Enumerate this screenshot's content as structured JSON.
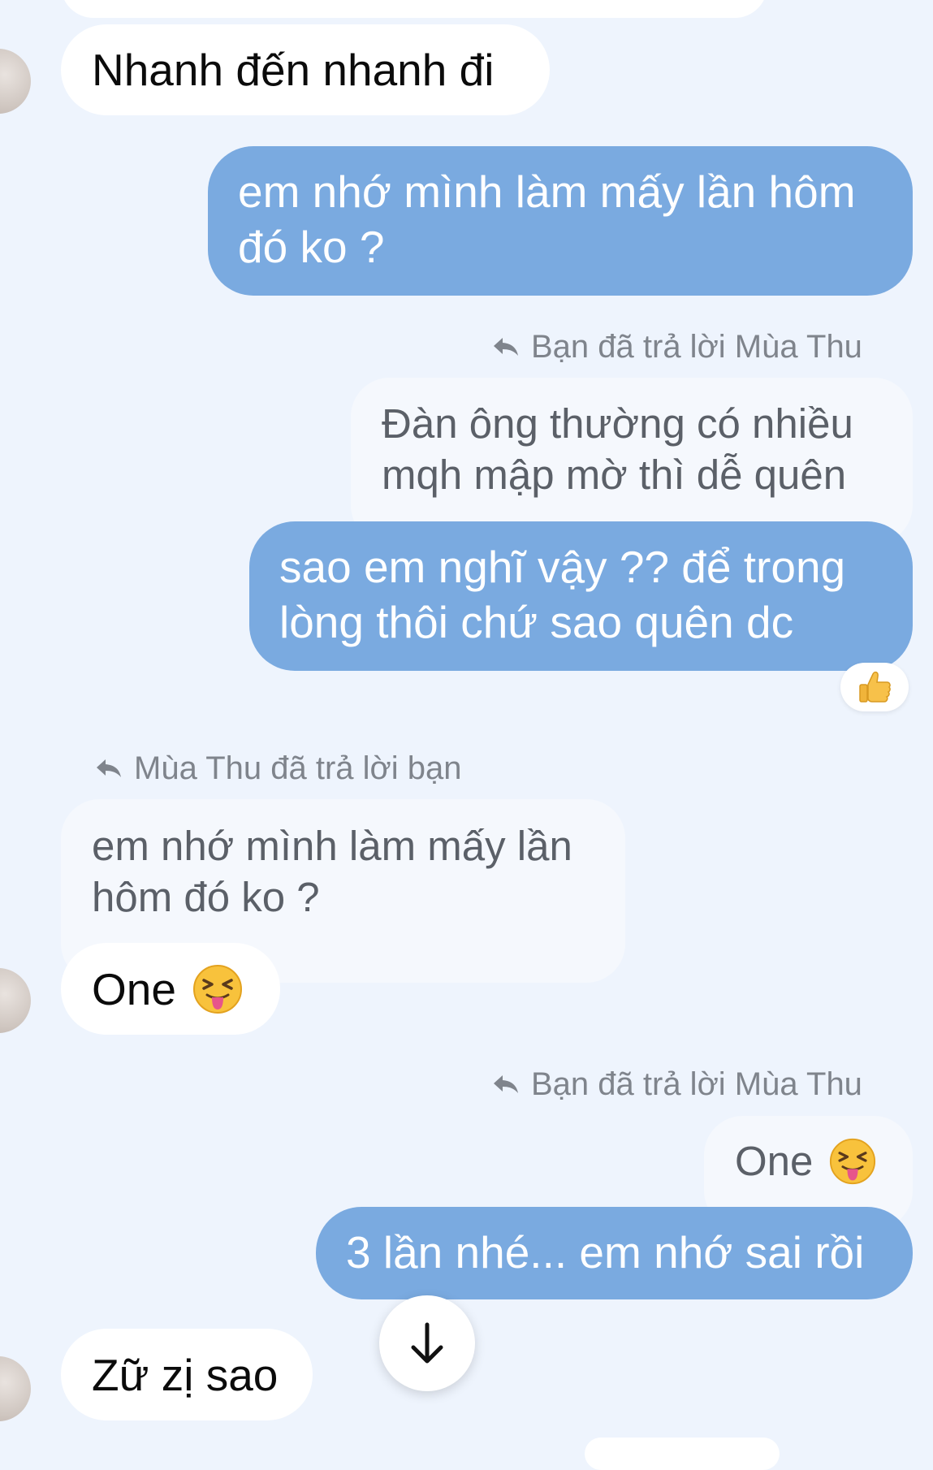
{
  "messages": {
    "m1": {
      "text": "Nhanh đến nhanh đi"
    },
    "m2": {
      "line1": "em nhớ mình làm mấy lần hôm",
      "line2": "đó ko ?"
    },
    "r1": {
      "note": "Bạn đã trả lời Mùa Thu",
      "quote_line1": "Đàn ông thường có nhiều",
      "quote_line2": "mqh mập mờ thì dễ quên"
    },
    "m3": {
      "line1": "sao em nghĩ vậy ?? để trong",
      "line2": "lòng thôi chứ sao quên dc",
      "reaction": "thumbs-up"
    },
    "r2": {
      "note": "Mùa Thu đã trả lời bạn",
      "quote_line1": "em nhớ mình làm mấy lần",
      "quote_line2": "hôm đó ko ?"
    },
    "m4": {
      "text": "One",
      "emoji": "squinting-tongue-face"
    },
    "r3": {
      "note": "Bạn đã trả lời Mùa Thu",
      "quote_text": "One",
      "quote_emoji": "squinting-tongue-face"
    },
    "m5": {
      "text": "3 lần nhé... em nhớ sai rồi"
    },
    "m6": {
      "text": "Zữ zị sao"
    }
  },
  "icons": {
    "reply": "reply-arrow-icon",
    "scroll": "arrow-down-icon"
  },
  "colors": {
    "background": "#eef4fd",
    "outgoing_bubble": "#7aaae0",
    "incoming_bubble": "#ffffff",
    "quoted_bubble": "#f5f8fd",
    "meta_text": "#7f848c"
  }
}
